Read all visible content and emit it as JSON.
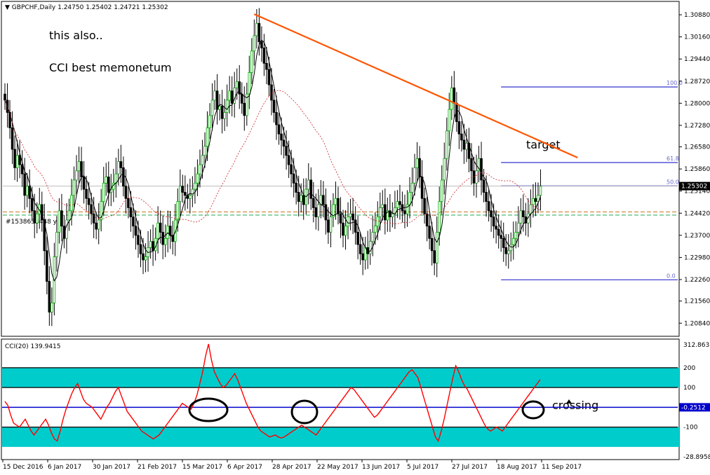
{
  "chart_data": [
    {
      "type": "candlestick",
      "title": "GBPCHF,Daily",
      "ohlc_header": "1.24750 1.25402 1.24721 1.25302",
      "last_price_label": "1.25302",
      "symbol_marker_label": "#1538638448  y 0",
      "y_ticks": [
        "1.30880",
        "1.30160",
        "1.29440",
        "1.28720",
        "1.28000",
        "1.27280",
        "1.26580",
        "1.25860",
        "1.25140",
        "1.24420",
        "1.23700",
        "1.22980",
        "1.22260",
        "1.21560",
        "1.20840"
      ],
      "ylim": [
        1.2055,
        1.3095
      ],
      "annotations": [
        "this also..",
        "CCI best memonetum",
        "target"
      ],
      "fibonacci_levels": [
        {
          "label": "100.0",
          "value": 1.2853
        },
        {
          "label": "61.8",
          "value": 1.2607
        },
        {
          "label": "50.0",
          "value": 1.2531
        },
        {
          "label": "0.0",
          "value": 1.2225
        }
      ],
      "trendline": {
        "from": {
          "index": 101,
          "price": 1.309
        },
        "to": {
          "index": 232,
          "price": 1.2623
        }
      },
      "closes": [
        1.281,
        1.277,
        1.272,
        1.265,
        1.259,
        1.263,
        1.26,
        1.257,
        1.25,
        1.253,
        1.249,
        1.245,
        1.241,
        1.244,
        1.247,
        1.242,
        1.232,
        1.222,
        1.212,
        1.215,
        1.23,
        1.238,
        1.245,
        1.24,
        1.236,
        1.242,
        1.245,
        1.25,
        1.255,
        1.258,
        1.261,
        1.256,
        1.252,
        1.249,
        1.247,
        1.244,
        1.241,
        1.239,
        1.242,
        1.248,
        1.254,
        1.256,
        1.251,
        1.252,
        1.254,
        1.257,
        1.261,
        1.259,
        1.253,
        1.249,
        1.246,
        1.243,
        1.24,
        1.237,
        1.234,
        1.231,
        1.229,
        1.23,
        1.233,
        1.235,
        1.232,
        1.236,
        1.241,
        1.238,
        1.234,
        1.236,
        1.24,
        1.237,
        1.235,
        1.242,
        1.248,
        1.253,
        1.251,
        1.25,
        1.249,
        1.25,
        1.252,
        1.254,
        1.257,
        1.26,
        1.263,
        1.266,
        1.272,
        1.276,
        1.281,
        1.284,
        1.278,
        1.279,
        1.275,
        1.277,
        1.281,
        1.284,
        1.28,
        1.285,
        1.287,
        1.283,
        1.28,
        1.276,
        1.283,
        1.29,
        1.297,
        1.302,
        1.306,
        1.3,
        1.298,
        1.293,
        1.291,
        1.286,
        1.281,
        1.277,
        1.273,
        1.27,
        1.268,
        1.266,
        1.263,
        1.26,
        1.257,
        1.254,
        1.251,
        1.248,
        1.25,
        1.247,
        1.252,
        1.255,
        1.249,
        1.246,
        1.243,
        1.247,
        1.25,
        1.247,
        1.242,
        1.238,
        1.243,
        1.247,
        1.249,
        1.244,
        1.241,
        1.237,
        1.24,
        1.243,
        1.244,
        1.242,
        1.238,
        1.234,
        1.231,
        1.229,
        1.233,
        1.231,
        1.235,
        1.238,
        1.24,
        1.243,
        1.246,
        1.247,
        1.242,
        1.245,
        1.243,
        1.244,
        1.246,
        1.248,
        1.247,
        1.245,
        1.244,
        1.247,
        1.251,
        1.254,
        1.259,
        1.262,
        1.256,
        1.249,
        1.244,
        1.24,
        1.236,
        1.232,
        1.228,
        1.238,
        1.248,
        1.255,
        1.262,
        1.271,
        1.278,
        1.285,
        1.28,
        1.274,
        1.27,
        1.268,
        1.265,
        1.267,
        1.262,
        1.258,
        1.254,
        1.258,
        1.262,
        1.255,
        1.251,
        1.248,
        1.245,
        1.243,
        1.24,
        1.239,
        1.237,
        1.236,
        1.233,
        1.231,
        1.232,
        1.234,
        1.236,
        1.238,
        1.241,
        1.245,
        1.243,
        1.241,
        1.244,
        1.247,
        1.249,
        1.248,
        1.25,
        1.253
      ],
      "markers": {
        "ma_fast_period_note": "",
        "horizontal_dashed_levels": [
          1.2446,
          1.2436
        ]
      }
    },
    {
      "type": "line",
      "title": "CCI(20) 139.9415",
      "right_top_label": "312.8637",
      "right_bottom_label": "-28.8958",
      "current_value_label": "-0.2512",
      "levels": [
        200,
        100,
        -100
      ],
      "level_labels": [
        "200",
        "100",
        "-100"
      ],
      "ylim": [
        -250,
        320
      ],
      "annotation": "crossing",
      "x_labels": [
        "15 Dec 2016",
        "6 Jan 2017",
        "30 Jan 2017",
        "21 Feb 2017",
        "15 Mar 2017",
        "6 Apr 2017",
        "28 Apr 2017",
        "22 May 2017",
        "13 Jun 2017",
        "5 Jul 2017",
        "27 Jul 2017",
        "18 Aug 2017",
        "11 Sep 2017"
      ],
      "values": [
        30,
        10,
        -40,
        -80,
        -90,
        -100,
        -80,
        -60,
        -90,
        -120,
        -140,
        -120,
        -100,
        -80,
        -60,
        -90,
        -130,
        -160,
        -170,
        -120,
        -60,
        -10,
        30,
        70,
        100,
        120,
        80,
        40,
        20,
        10,
        0,
        -20,
        -40,
        -60,
        -30,
        0,
        20,
        50,
        80,
        100,
        60,
        20,
        -20,
        -40,
        -60,
        -80,
        -100,
        -120,
        -130,
        -140,
        -150,
        -160,
        -150,
        -140,
        -120,
        -100,
        -80,
        -60,
        -40,
        -20,
        0,
        20,
        10,
        0,
        -10,
        20,
        60,
        120,
        180,
        260,
        320,
        240,
        180,
        150,
        120,
        100,
        110,
        130,
        150,
        170,
        140,
        100,
        60,
        20,
        -10,
        -40,
        -70,
        -100,
        -120,
        -130,
        -140,
        -150,
        -145,
        -140,
        -150,
        -155,
        -150,
        -140,
        -130,
        -120,
        -110,
        -100,
        -90,
        -100,
        -110,
        -120,
        -130,
        -140,
        -120,
        -100,
        -80,
        -60,
        -40,
        -20,
        0,
        20,
        40,
        60,
        80,
        100,
        90,
        70,
        50,
        30,
        10,
        -10,
        -30,
        -50,
        -40,
        -20,
        0,
        20,
        40,
        60,
        80,
        100,
        120,
        140,
        160,
        180,
        190,
        170,
        150,
        100,
        50,
        0,
        -50,
        -100,
        -150,
        -170,
        -120,
        -60,
        10,
        80,
        150,
        210,
        180,
        140,
        110,
        90,
        60,
        30,
        0,
        -30,
        -60,
        -90,
        -110,
        -120,
        -110,
        -100,
        -110,
        -120,
        -100,
        -80,
        -60,
        -40,
        -20,
        0,
        20,
        40,
        60,
        80,
        100,
        120,
        140
      ]
    }
  ]
}
